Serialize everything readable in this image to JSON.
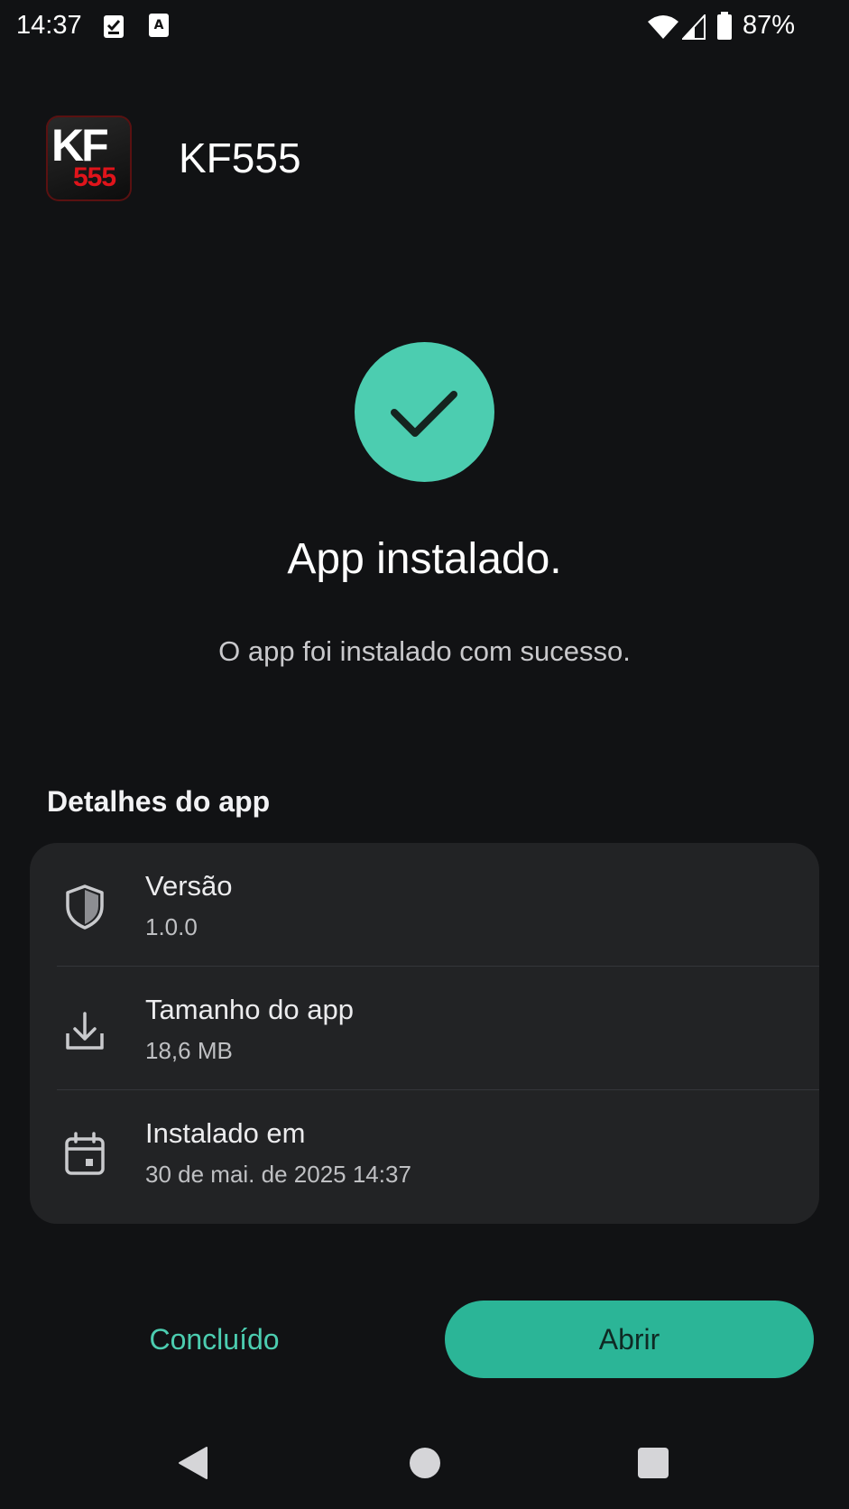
{
  "status_bar": {
    "time": "14:37",
    "battery": "87%",
    "icons": [
      "task-check-icon",
      "keyboard-a-icon",
      "wifi-icon",
      "cell-signal-icon",
      "battery-icon"
    ]
  },
  "app": {
    "name": "KF555",
    "icon_text_top": "KF",
    "icon_text_bottom": "555"
  },
  "main": {
    "title": "App instalado.",
    "subtitle": "O app foi instalado com sucesso."
  },
  "details": {
    "section_title": "Detalhes do app",
    "rows": [
      {
        "icon": "shield-icon",
        "label": "Versão",
        "value": "1.0.0"
      },
      {
        "icon": "download-icon",
        "label": "Tamanho do app",
        "value": "18,6 MB"
      },
      {
        "icon": "calendar-icon",
        "label": "Instalado em",
        "value": "30 de mai. de 2025 14:37"
      }
    ]
  },
  "actions": {
    "done_label": "Concluído",
    "open_label": "Abrir"
  },
  "colors": {
    "accent": "#4ccdb0",
    "button": "#2bb597",
    "background": "#111214",
    "card": "#222325"
  }
}
